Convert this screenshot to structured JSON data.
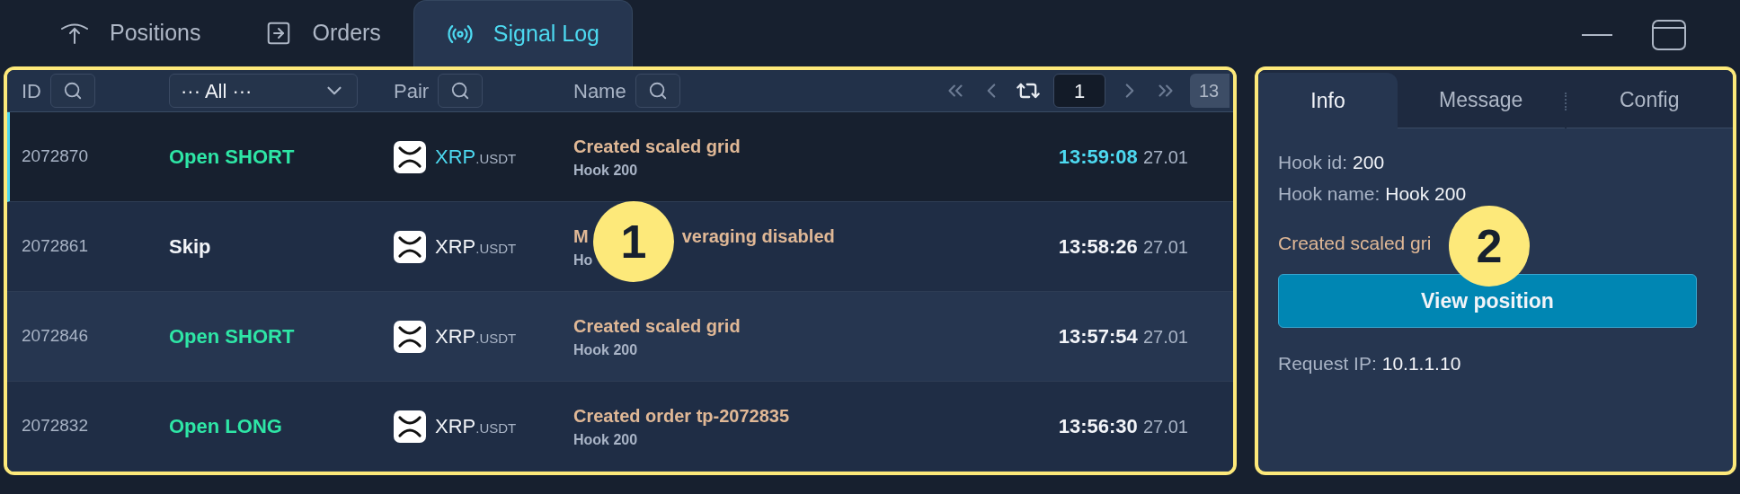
{
  "tabs": [
    {
      "label": "Positions",
      "kind": "positions",
      "selected": false
    },
    {
      "label": "Orders",
      "kind": "orders",
      "selected": false
    },
    {
      "label": "Signal Log",
      "kind": "signal",
      "selected": true
    }
  ],
  "table": {
    "columns": [
      {
        "label": "ID"
      },
      {
        "label": "··· All ···"
      },
      {
        "label": "Pair"
      },
      {
        "label": "Name"
      }
    ],
    "pagination": {
      "page": "1",
      "total": "13"
    },
    "rows": [
      {
        "id": "2072870",
        "action": "Open SHORT",
        "kind": "open",
        "base": "XRP",
        "quote": ".USDT",
        "name_parts": [
          "Created scaled grid"
        ],
        "hook": "Hook 200",
        "time": "13:59:08",
        "date": "27.01",
        "selected": true
      },
      {
        "id": "2072861",
        "action": "Skip",
        "kind": "skip",
        "base": "XRP",
        "quote": ".USDT",
        "name_parts": [
          "M",
          "veraging disabled"
        ],
        "hook": "Ho",
        "time": "13:58:26",
        "date": "27.01",
        "selected": false
      },
      {
        "id": "2072846",
        "action": "Open SHORT",
        "kind": "open",
        "base": "XRP",
        "quote": ".USDT",
        "name_parts": [
          "Created scaled grid"
        ],
        "hook": "Hook 200",
        "time": "13:57:54",
        "date": "27.01",
        "selected": false
      },
      {
        "id": "2072832",
        "action": "Open LONG",
        "kind": "open",
        "base": "XRP",
        "quote": ".USDT",
        "name_parts": [
          "Created order tp-2072835"
        ],
        "hook": "Hook 200",
        "time": "13:56:30",
        "date": "27.01",
        "selected": false
      }
    ]
  },
  "details": {
    "tabs": [
      {
        "label": "Info",
        "selected": true
      },
      {
        "label": "Message",
        "selected": false
      },
      {
        "label": "Config",
        "selected": false
      }
    ],
    "fields": [
      {
        "label": "Hook id:",
        "value": "200"
      },
      {
        "label": "Hook name:",
        "value": "Hook 200"
      }
    ],
    "message": "Created scaled gri",
    "button": "View position",
    "request_ip": {
      "label": "Request IP:",
      "value": "10.1.1.10"
    }
  },
  "annotations": [
    {
      "label": "1"
    },
    {
      "label": "2"
    }
  ]
}
